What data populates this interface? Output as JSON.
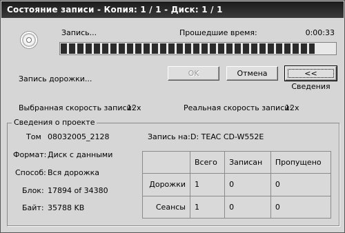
{
  "window": {
    "title": "Состояние записи - Копия: 1 / 1 - Диск: 1 / 1"
  },
  "status": {
    "writing_label": "Запись...",
    "elapsed_label": "Прошедшие время:",
    "elapsed_value": "0:00:33",
    "progress_fraction": 0.92,
    "track_status": "Запись дорожки..."
  },
  "buttons": {
    "ok": "OK",
    "cancel": "Отмена",
    "details": "<< Сведения"
  },
  "speed": {
    "selected_label": "Выбранная скорость записи:",
    "selected_value": "12x",
    "actual_label": "Реальная скорость записи:",
    "actual_value": "12x"
  },
  "project": {
    "group_title": "Сведения о проекте",
    "volume_label": "Том",
    "volume_value": "08032005_2128",
    "format_label": "Формат:",
    "format_value": "Диск с данными",
    "method_label": "Способ:",
    "method_value": "Вся дорожка",
    "block_label": "Блок:",
    "block_value": "17894 of 34380",
    "bytes_label": "Байт:",
    "bytes_value": "35788 KB",
    "target_label": "Запись на:",
    "target_value": "D: TEAC CD-W552E"
  },
  "stats_table": {
    "columns": [
      "",
      "Всего",
      "Записан",
      "Пропущено"
    ],
    "rows": [
      {
        "label": "Дорожки",
        "total": "1",
        "written": "0",
        "skipped": "0"
      },
      {
        "label": "Сеансы",
        "total": "1",
        "written": "0",
        "skipped": "0"
      }
    ]
  }
}
